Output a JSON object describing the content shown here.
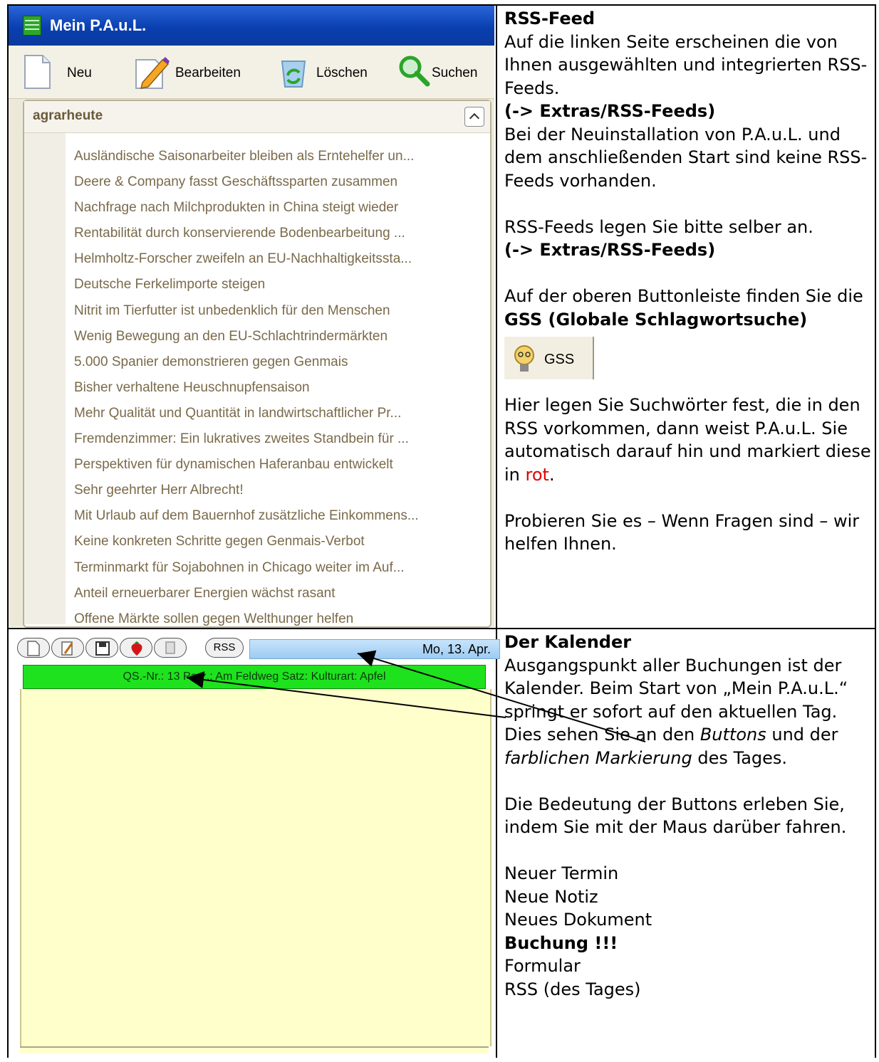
{
  "window": {
    "title": "Mein P.A.u.L.",
    "toolbar": {
      "new": "Neu",
      "edit": "Bearbeiten",
      "delete": "Löschen",
      "search": "Suchen"
    }
  },
  "feed": {
    "source": "agrarheute",
    "items": [
      "Ausländische Saisonarbeiter bleiben als Erntehelfer un...",
      "Deere & Company fasst Geschäftssparten zusammen",
      "Nachfrage nach Milchprodukten in China steigt wieder",
      "Rentabilität durch konservierende Bodenbearbeitung ...",
      "Helmholtz-Forscher zweifeln an EU-Nachhaltigkeitssta...",
      "Deutsche Ferkelimporte steigen",
      "Nitrit im Tierfutter ist unbedenklich für den Menschen",
      "Wenig Bewegung an den EU-Schlachtrindermärkten",
      "5.000 Spanier demonstrieren gegen Genmais",
      "Bisher verhaltene Heuschnupfensaison",
      "Mehr Qualität und Quantität in landwirtschaftlicher Pr...",
      "Fremdenzimmer: Ein lukratives zweites Standbein für ...",
      "Perspektiven für dynamischen Haferanbau entwickelt",
      "Sehr geehrter Herr Albrecht!",
      "Mit Urlaub auf dem Bauernhof zusätzliche Einkommens...",
      "Keine konkreten Schritte gegen Genmais-Verbot",
      "Terminmarkt für Sojabohnen in Chicago weiter im Auf...",
      "Anteil erneuerbarer Energien wächst rasant",
      "Offene Märkte sollen gegen Welthunger helfen"
    ]
  },
  "calendar": {
    "rss_button": "RSS",
    "date": "Mo, 13. Apr.",
    "booking": "QS.-Nr.: 13 Parz.: Am Feldweg Satz:  Kulturart: Apfel"
  },
  "rss_section": {
    "heading": "RSS-Feed",
    "p1": "Auf die linken Seite erscheinen die von Ihnen ausgewählten und integrierten RSS-Feeds.",
    "ref1": "(-> Extras/RSS-Feeds)",
    "p2": "Bei der Neuinstallation von P.A.u.L. und dem anschließenden Start sind keine RSS-Feeds  vorhanden.",
    "p3": "RSS-Feeds legen Sie bitte selber an.",
    "ref2": "(-> Extras/RSS-Feeds)",
    "p4_pre": "Auf der oberen Buttonleiste finden Sie die ",
    "p4_bold": "GSS (Globale Schlagwortsuche)",
    "gss_button": "GSS",
    "p5_pre": "Hier legen Sie Suchwörter fest, die in den RSS vorkommen, dann weist P.A.u.L. Sie automatisch darauf hin und markiert diese in ",
    "p5_red": "rot",
    "p5_post": ".",
    "p6": "Probieren Sie es – Wenn Fragen sind – wir helfen Ihnen."
  },
  "calendar_section": {
    "heading": "Der Kalender",
    "p1": "Ausgangspunkt aller Buchungen ist der Kalender. Beim Start von „Mein P.A.u.L.“ springt er sofort auf den aktuellen Tag. Dies sehen Sie an den ",
    "p1_it1": "Buttons",
    "p1_mid": " und der ",
    "p1_it2": "farblichen Markierung",
    "p1_post": " des Tages.",
    "p2": "Die Bedeutung der Buttons erleben Sie, indem Sie mit der Maus darüber fahren.",
    "list": [
      "Neuer Termin",
      "Neue Notiz",
      "Neues Dokument"
    ],
    "list_bold": "Buchung !!!",
    "list_after": [
      "Formular",
      "RSS (des Tages)"
    ]
  },
  "colors": {
    "booking_green": "#1ee21e",
    "calendar_yellow": "#ffffcc",
    "highlight_red": "#e00000"
  }
}
